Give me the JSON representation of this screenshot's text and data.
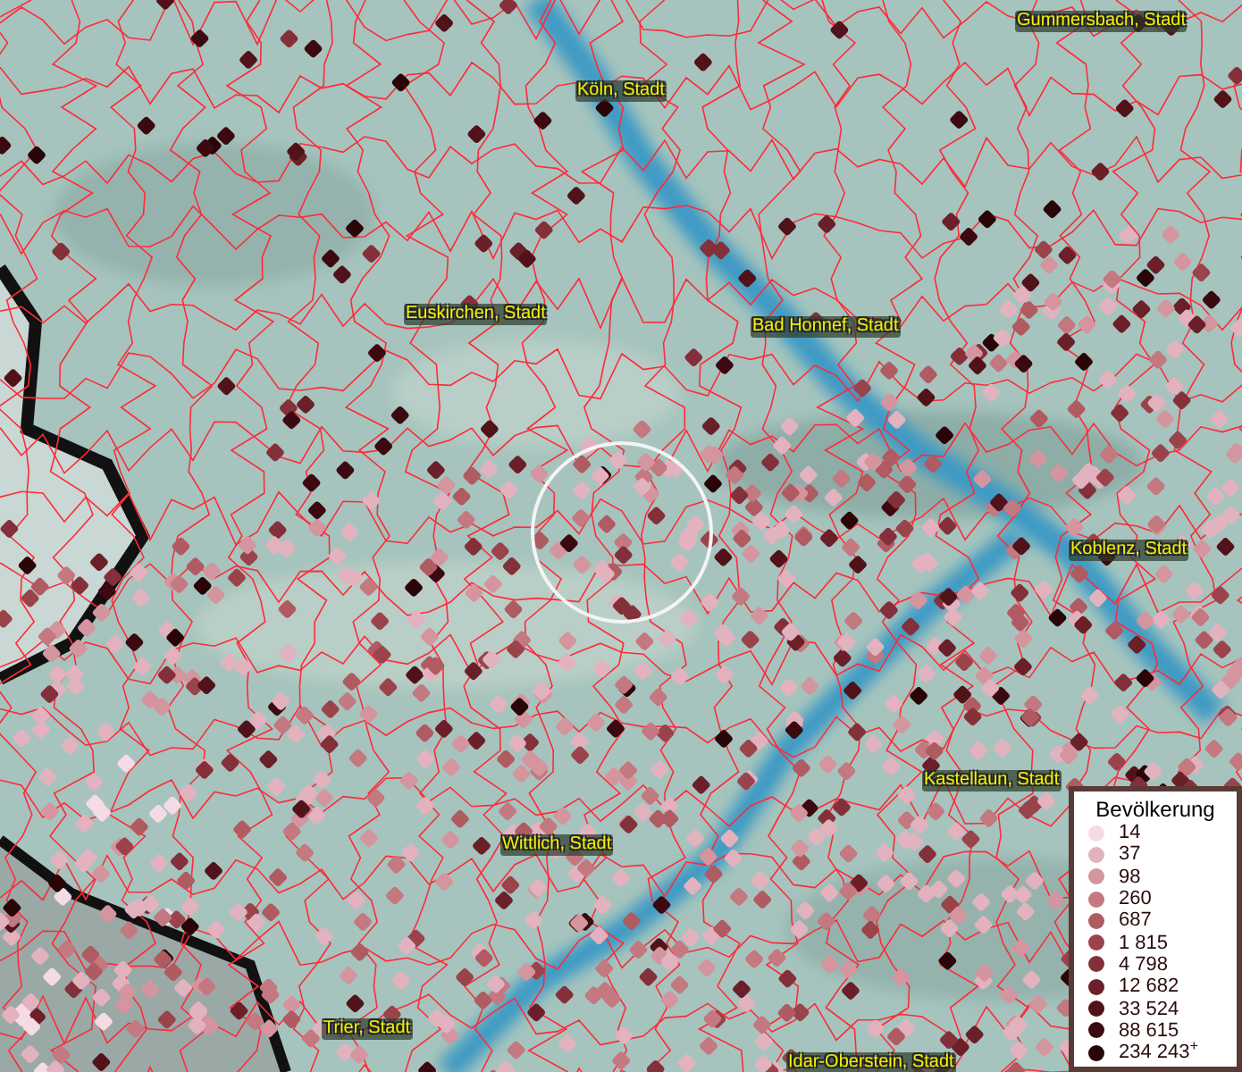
{
  "map": {
    "places": [
      {
        "name": "Gummersbach, Stadt"
      },
      {
        "name": "Köln, Stadt"
      },
      {
        "name": "Euskirchen, Stadt"
      },
      {
        "name": "Bad Honnef, Stadt"
      },
      {
        "name": "Koblenz, Stadt"
      },
      {
        "name": "Kastellaun, Stadt"
      },
      {
        "name": "Wittlich, Stadt"
      },
      {
        "name": "Trier, Stadt"
      },
      {
        "name": "Idar-Oberstein, Stadt"
      }
    ]
  },
  "legend": {
    "title": "Bevölkerung",
    "items": [
      {
        "label": "14",
        "color": "#f5dbe5"
      },
      {
        "label": "37",
        "color": "#e3b2bf"
      },
      {
        "label": "98",
        "color": "#d4959f"
      },
      {
        "label": "260",
        "color": "#c4787f"
      },
      {
        "label": "687",
        "color": "#b05a62"
      },
      {
        "label": "1 815",
        "color": "#9a434b"
      },
      {
        "label": "4 798",
        "color": "#84303a"
      },
      {
        "label": "12 682",
        "color": "#6b1f28"
      },
      {
        "label": "33 524",
        "color": "#52121a"
      },
      {
        "label": "88 615",
        "color": "#3c0910"
      },
      {
        "label": "234 243$^{+}$",
        "color": "#2a0508"
      }
    ]
  }
}
